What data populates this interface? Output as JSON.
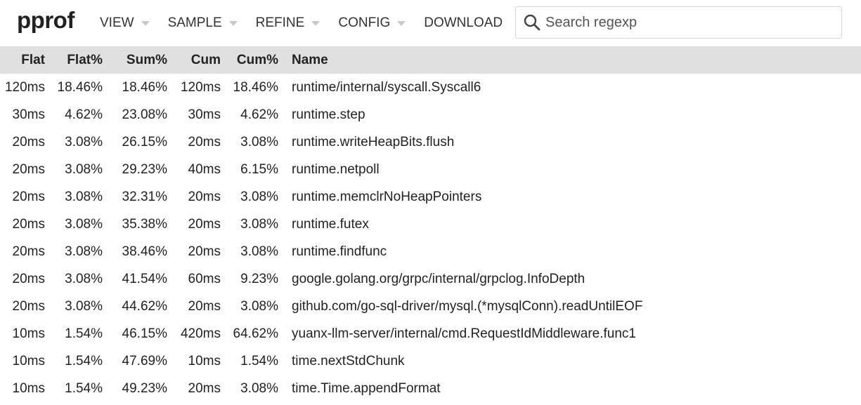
{
  "app": {
    "logo": "pprof"
  },
  "menu": [
    {
      "label": "VIEW",
      "has_caret": true
    },
    {
      "label": "SAMPLE",
      "has_caret": true
    },
    {
      "label": "REFINE",
      "has_caret": true
    },
    {
      "label": "CONFIG",
      "has_caret": true
    },
    {
      "label": "DOWNLOAD",
      "has_caret": false
    }
  ],
  "search": {
    "placeholder": "Search regexp",
    "value": "",
    "icon": "search-icon"
  },
  "table": {
    "columns": [
      "Flat",
      "Flat%",
      "Sum%",
      "Cum",
      "Cum%",
      "Name"
    ],
    "rows": [
      [
        "120ms",
        "18.46%",
        "18.46%",
        "120ms",
        "18.46%",
        "runtime/internal/syscall.Syscall6"
      ],
      [
        "30ms",
        "4.62%",
        "23.08%",
        "30ms",
        "4.62%",
        "runtime.step"
      ],
      [
        "20ms",
        "3.08%",
        "26.15%",
        "20ms",
        "3.08%",
        "runtime.writeHeapBits.flush"
      ],
      [
        "20ms",
        "3.08%",
        "29.23%",
        "40ms",
        "6.15%",
        "runtime.netpoll"
      ],
      [
        "20ms",
        "3.08%",
        "32.31%",
        "20ms",
        "3.08%",
        "runtime.memclrNoHeapPointers"
      ],
      [
        "20ms",
        "3.08%",
        "35.38%",
        "20ms",
        "3.08%",
        "runtime.futex"
      ],
      [
        "20ms",
        "3.08%",
        "38.46%",
        "20ms",
        "3.08%",
        "runtime.findfunc"
      ],
      [
        "20ms",
        "3.08%",
        "41.54%",
        "60ms",
        "9.23%",
        "google.golang.org/grpc/internal/grpclog.InfoDepth"
      ],
      [
        "20ms",
        "3.08%",
        "44.62%",
        "20ms",
        "3.08%",
        "github.com/go-sql-driver/mysql.(*mysqlConn).readUntilEOF"
      ],
      [
        "10ms",
        "1.54%",
        "46.15%",
        "420ms",
        "64.62%",
        "yuanx-llm-server/internal/cmd.RequestIdMiddleware.func1"
      ],
      [
        "10ms",
        "1.54%",
        "47.69%",
        "10ms",
        "1.54%",
        "time.nextStdChunk"
      ],
      [
        "10ms",
        "1.54%",
        "49.23%",
        "20ms",
        "3.08%",
        "time.Time.appendFormat"
      ]
    ]
  }
}
